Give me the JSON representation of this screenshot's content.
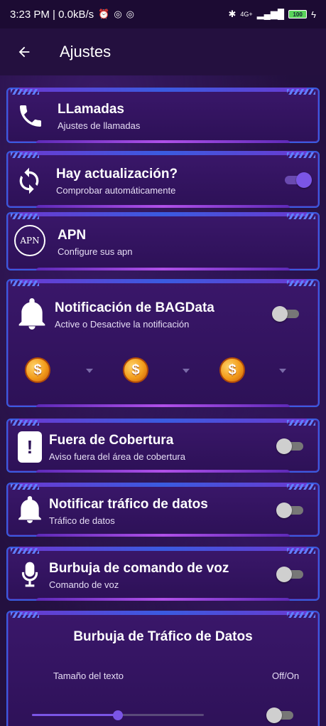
{
  "status_bar": {
    "time_speed": "3:23 PM | 0.0kB/s",
    "network": "4G+",
    "battery": "100"
  },
  "app_bar": {
    "title": "Ajustes"
  },
  "settings": {
    "calls": {
      "title": "LLamadas",
      "subtitle": "Ajustes de llamadas"
    },
    "update": {
      "title": "Hay actualización?",
      "subtitle": "Comprobar automáticamente",
      "enabled": true
    },
    "apn": {
      "title": "APN",
      "subtitle": "Configure sus apn",
      "badge": "APN"
    },
    "notification": {
      "title": "Notificación de BAGData",
      "subtitle": "Active o Desactive la notificación",
      "enabled": false,
      "coin_symbol": "$"
    },
    "coverage": {
      "title": "Fuera de Cobertura",
      "subtitle": "Aviso fuera del área de cobertura",
      "enabled": false
    },
    "traffic": {
      "title": "Notificar tráfico de datos",
      "subtitle": "Tráfico de datos",
      "enabled": false
    },
    "voice": {
      "title": "Burbuja de comando de voz",
      "subtitle": "Comando de voz",
      "enabled": false
    },
    "bubble": {
      "title": "Burbuja de Tráfico de Datos",
      "text_size_label": "Tamaño del texto",
      "off_on_label": "Off/On",
      "text_size_fraction": 0.5,
      "enabled": false
    }
  },
  "colors": {
    "background": "#23103f",
    "card_border": "#3a5be0",
    "accent": "#7b55e6"
  }
}
